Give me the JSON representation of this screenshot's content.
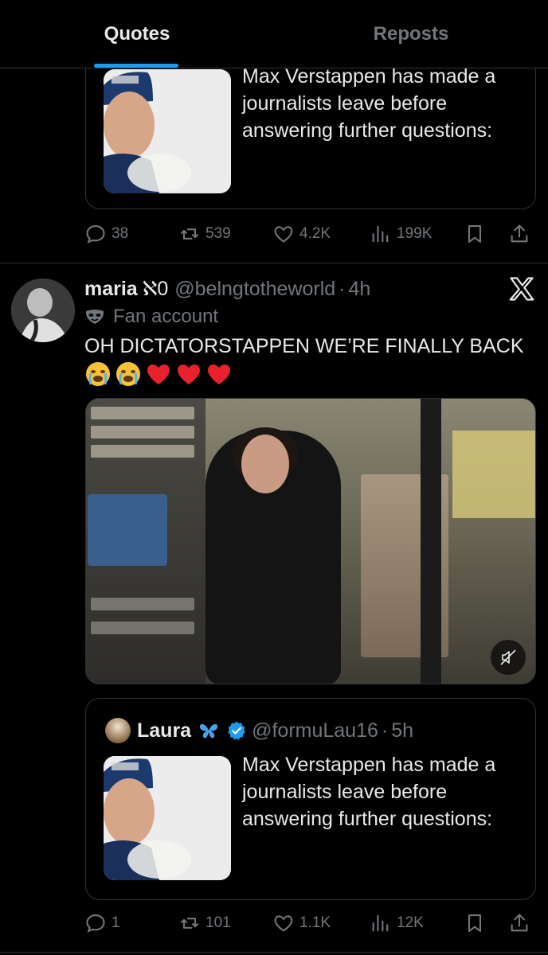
{
  "tabs": [
    {
      "label": "Quotes",
      "active": true
    },
    {
      "label": "Reposts",
      "active": false
    }
  ],
  "top_post": {
    "quote_text": "Max Verstappen has made a journalists leave before answering further questions:",
    "actions": {
      "replies": "38",
      "reposts": "539",
      "likes": "4.2K",
      "views": "199K"
    }
  },
  "main_post": {
    "name": "maria",
    "name_emoji": "ℵ0",
    "handle": "@belngtotheworld",
    "separator": "·",
    "time": "4h",
    "fan_label": "Fan account",
    "text": "OH DICTATORSTAPPEN WE’RE FINALLY BACK",
    "emojis": [
      "crying-face",
      "crying-face",
      "red-heart",
      "red-heart",
      "red-heart"
    ],
    "quoted": {
      "name": "Laura",
      "handle": "@formuLau16",
      "separator": "·",
      "time": "5h",
      "text": "Max Verstappen has made a journalists leave before answering further questions:"
    },
    "actions": {
      "replies": "1",
      "reposts": "101",
      "likes": "1.1K",
      "views": "12K"
    }
  },
  "colors": {
    "accent": "#1d9bf0",
    "muted": "#71767b",
    "text": "#e7e9ea",
    "border": "#2f3336",
    "heart": "#e8222d"
  }
}
